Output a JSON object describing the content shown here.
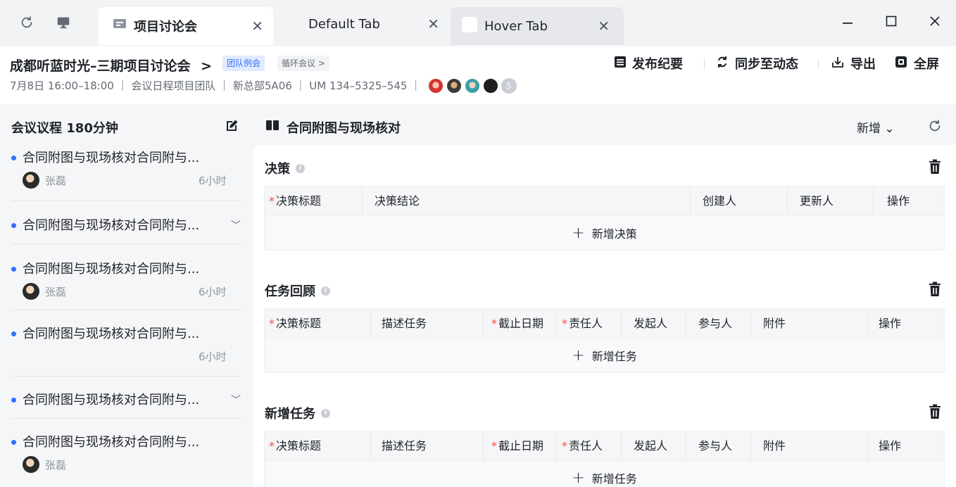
{
  "tabs": [
    {
      "label": "项目讨论会",
      "close": "✕",
      "state": "active"
    },
    {
      "label": "Default Tab",
      "close": "✕",
      "state": "default"
    },
    {
      "label": "Hover Tab",
      "close": "✕",
      "state": "hover"
    }
  ],
  "icons": {
    "refresh": "refresh-icon",
    "monitor": "monitor-icon",
    "chat": "chat-icon",
    "minimize": "minimize-icon",
    "maximize": "maximize-icon",
    "close": "close-icon"
  },
  "header": {
    "title": "成都听蓝时光–三期项目讨论会",
    "title_arrow": ">",
    "badge_primary": "团队例会",
    "badge_secondary": "循环会议 >",
    "meta": "7月8日 16:00–18:00 ｜ 会议日程项目团队 ｜ 新总部5A06 ｜ UM 134–5325–545 ｜",
    "attendee_count": "5",
    "actions": [
      {
        "label": "发布纪要",
        "icon": "document-icon"
      },
      {
        "label": "同步至动态",
        "icon": "sync-icon"
      },
      {
        "label": "导出",
        "icon": "export-icon"
      },
      {
        "label": "全屏",
        "icon": "fullscreen-icon"
      }
    ]
  },
  "sidebar": {
    "title": "会议议程 180分钟",
    "items": [
      {
        "title": "合同附图与现场核对合同附与...",
        "person": "张磊",
        "duration": "6小时",
        "chevron": ""
      },
      {
        "title": "合同附图与现场核对合同附与...",
        "person": "",
        "duration": "",
        "chevron": "﹀"
      },
      {
        "title": "合同附图与现场核对合同附与...",
        "person": "张磊",
        "duration": "6小时",
        "chevron": ""
      },
      {
        "title": "合同附图与现场核对合同附与...",
        "person": "",
        "duration": "6小时",
        "chevron": ""
      },
      {
        "title": "合同附图与现场核对合同附与...",
        "person": "",
        "duration": "",
        "chevron": "﹀"
      },
      {
        "title": "合同附图与现场核对合同附与...",
        "person": "张磊",
        "duration": "",
        "chevron": ""
      }
    ]
  },
  "main": {
    "title": "合同附图与现场核对",
    "new_label": "新增 ⌄",
    "sections": [
      {
        "title": "决策",
        "columns": [
          {
            "label": "决策标题",
            "required": true
          },
          {
            "label": "决策结论",
            "required": false
          },
          {
            "label": "创建人",
            "required": false
          },
          {
            "label": "更新人",
            "required": false
          },
          {
            "label": "操作",
            "required": false
          }
        ],
        "add_label": "新增决策"
      },
      {
        "title": "任务回顾",
        "columns": [
          {
            "label": "决策标题",
            "required": true
          },
          {
            "label": "描述任务",
            "required": false
          },
          {
            "label": "截止日期",
            "required": true
          },
          {
            "label": "责任人",
            "required": true
          },
          {
            "label": "发起人",
            "required": false
          },
          {
            "label": "参与人",
            "required": false
          },
          {
            "label": "附件",
            "required": false
          },
          {
            "label": "操作",
            "required": false
          }
        ],
        "add_label": "新增任务"
      },
      {
        "title": "新增任务",
        "columns": [
          {
            "label": "决策标题",
            "required": true
          },
          {
            "label": "描述任务",
            "required": false
          },
          {
            "label": "截止日期",
            "required": true
          },
          {
            "label": "责任人",
            "required": true
          },
          {
            "label": "发起人",
            "required": false
          },
          {
            "label": "参与人",
            "required": false
          },
          {
            "label": "附件",
            "required": false
          },
          {
            "label": "操作",
            "required": false
          }
        ],
        "add_label": "新增任务"
      }
    ]
  },
  "colors": {
    "accent": "#3370ff",
    "required": "#f54a45",
    "sidebar_bg": "#f5f6f7"
  }
}
